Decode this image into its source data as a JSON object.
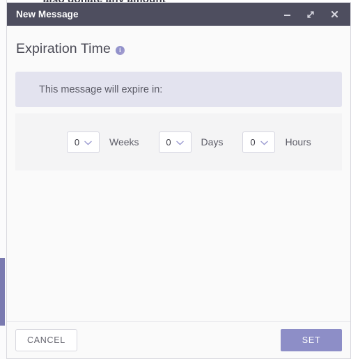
{
  "background": {
    "headline_text": "also donate any amount",
    "scrollbar": {
      "name": "vertical-scrollbar",
      "thumb_color": "#7a7ab0"
    }
  },
  "window": {
    "title": "New Message",
    "titlebar_color": "#4e4e5f",
    "controls": {
      "minimize_label": "–",
      "maximize_label": "⤢",
      "close_label": "✕"
    }
  },
  "dialog": {
    "section_title": "Expiration Time",
    "info_icon_glyph": "i",
    "banner_text": "This message will expire in:",
    "banner_color": "#e3e3ef",
    "duration": [
      {
        "name": "weeks",
        "value": "0",
        "label": "Weeks"
      },
      {
        "name": "days",
        "value": "0",
        "label": "Days"
      },
      {
        "name": "hours",
        "value": "0",
        "label": "Hours"
      }
    ]
  },
  "footer": {
    "cancel_label": "CANCEL",
    "set_label": "SET",
    "set_color": "#8d8ec7"
  }
}
